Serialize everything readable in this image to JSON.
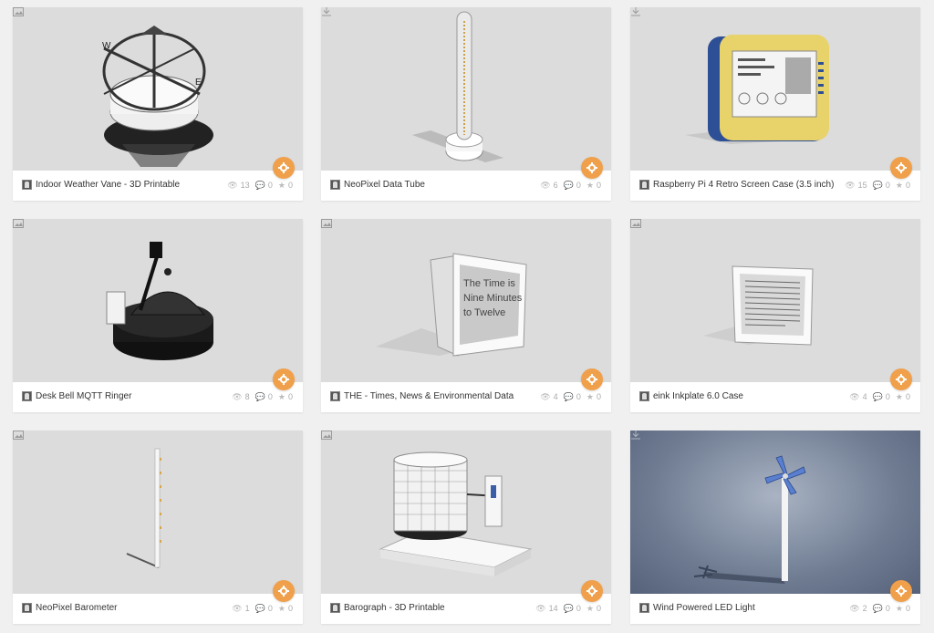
{
  "cards": [
    {
      "title": "Indoor Weather Vane - 3D Printable",
      "views": "13",
      "comments": "0",
      "likes": "0",
      "corner_icon": "image-icon"
    },
    {
      "title": "NeoPixel Data Tube",
      "views": "6",
      "comments": "0",
      "likes": "0",
      "corner_icon": "download-icon"
    },
    {
      "title": "Raspberry Pi 4 Retro Screen Case (3.5 inch)",
      "views": "15",
      "comments": "0",
      "likes": "0",
      "corner_icon": "download-icon"
    },
    {
      "title": "Desk Bell MQTT Ringer",
      "views": "8",
      "comments": "0",
      "likes": "0",
      "corner_icon": "image-icon"
    },
    {
      "title": "THE - Times, News & Environmental Data",
      "views": "4",
      "comments": "0",
      "likes": "0",
      "corner_icon": "image-icon",
      "screen_text": [
        "The Time is",
        "Nine Minutes",
        "to Twelve"
      ]
    },
    {
      "title": "eink Inkplate 6.0 Case",
      "views": "4",
      "comments": "0",
      "likes": "0",
      "corner_icon": "image-icon"
    },
    {
      "title": "NeoPixel Barometer",
      "views": "1",
      "comments": "0",
      "likes": "0",
      "corner_icon": "image-icon"
    },
    {
      "title": "Barograph - 3D Printable",
      "views": "14",
      "comments": "0",
      "likes": "0",
      "corner_icon": "image-icon"
    },
    {
      "title": "Wind Powered LED Light",
      "views": "2",
      "comments": "0",
      "likes": "0",
      "corner_icon": "download-icon"
    }
  ],
  "colors": {
    "gear": "#f0a04b",
    "background": "#f0f0f0",
    "thumb": "#dcdcdc"
  }
}
